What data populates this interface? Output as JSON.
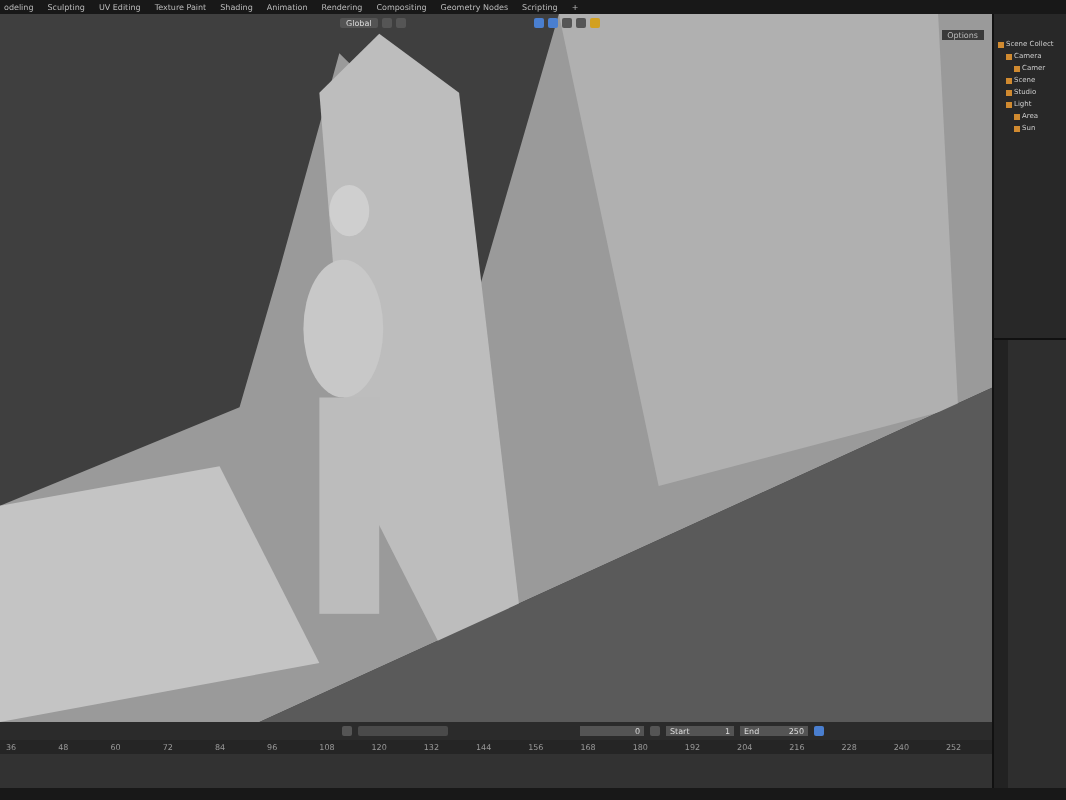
{
  "workspace_tabs": [
    {
      "label": "odeling",
      "selected": false
    },
    {
      "label": "Sculpting",
      "selected": false
    },
    {
      "label": "UV Editing",
      "selected": false
    },
    {
      "label": "Texture Paint",
      "selected": false
    },
    {
      "label": "Shading",
      "selected": false
    },
    {
      "label": "Animation",
      "selected": false
    },
    {
      "label": "Rendering",
      "selected": false
    },
    {
      "label": "Compositing",
      "selected": false
    },
    {
      "label": "Geometry Nodes",
      "selected": false
    },
    {
      "label": "Scripting",
      "selected": false
    }
  ],
  "add_tab": "+",
  "viewport_header": {
    "transform_orientation": "Global",
    "options": "Options"
  },
  "outliner": {
    "items": [
      {
        "name": "Scene Collect",
        "children": [
          {
            "name": "Camera",
            "children": [
              {
                "name": "Camer"
              }
            ]
          },
          {
            "name": "Scene"
          },
          {
            "name": "Studio"
          },
          {
            "name": "Light",
            "children": [
              {
                "name": "Area"
              },
              {
                "name": "Sun"
              }
            ]
          }
        ]
      }
    ]
  },
  "timeline": {
    "current_frame": "0",
    "start_label": "Start",
    "start": "1",
    "end_label": "End",
    "end": "250",
    "ruler": [
      "36",
      "48",
      "60",
      "72",
      "84",
      "96",
      "108",
      "120",
      "132",
      "144",
      "156",
      "168",
      "180",
      "192",
      "204",
      "216",
      "228",
      "240",
      "252"
    ]
  }
}
